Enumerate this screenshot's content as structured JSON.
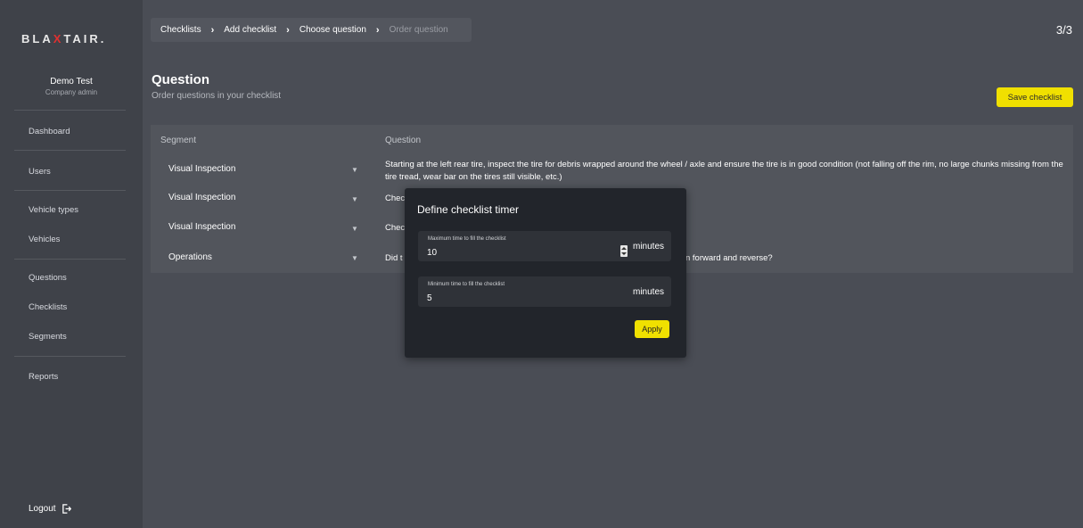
{
  "brand": {
    "logo_text_a": "BLA",
    "logo_text_x": "X",
    "logo_text_b": "TAIR",
    "logo_suffix": "."
  },
  "user": {
    "name": "Demo Test",
    "role": "Company admin"
  },
  "nav": {
    "dashboard": "Dashboard",
    "users": "Users",
    "vehicle_types": "Vehicle types",
    "vehicles": "Vehicles",
    "questions": "Questions",
    "checklists": "Checklists",
    "segments": "Segments",
    "reports": "Reports",
    "logout": "Logout"
  },
  "breadcrumb": [
    "Checklists",
    "Add checklist",
    "Choose question",
    "Order question"
  ],
  "step": "3/3",
  "header": {
    "title": "Question",
    "subtitle": "Order questions in your checklist",
    "save_label": "Save checklist"
  },
  "table": {
    "col_segment": "Segment",
    "col_question": "Question",
    "rows": [
      {
        "segment": "Visual Inspection",
        "question": "Starting at the left rear tire, inspect the tire for debris wrapped around the wheel / axle and ensure the tire is in good condition (not falling off the rim, no large chunks missing from the tire tread, wear bar on the tires still visible, etc.)"
      },
      {
        "segment": "Visual Inspection",
        "question": "Chec"
      },
      {
        "segment": "Visual Inspection",
        "question": "Chec"
      },
      {
        "segment": "Operations",
        "question": "Did t",
        "question_tail": "n forward and reverse?"
      }
    ]
  },
  "modal": {
    "title": "Define checklist timer",
    "max_label": "Maximum time to fill the checklist",
    "max_value": "10",
    "min_label": "Minimum time to fill the checklist",
    "min_value": "5",
    "unit": "minutes",
    "apply_label": "Apply"
  },
  "colors": {
    "accent": "#f0e000",
    "background": "#4a4d55",
    "sidebar": "#3f4249",
    "modal": "#22252b"
  }
}
